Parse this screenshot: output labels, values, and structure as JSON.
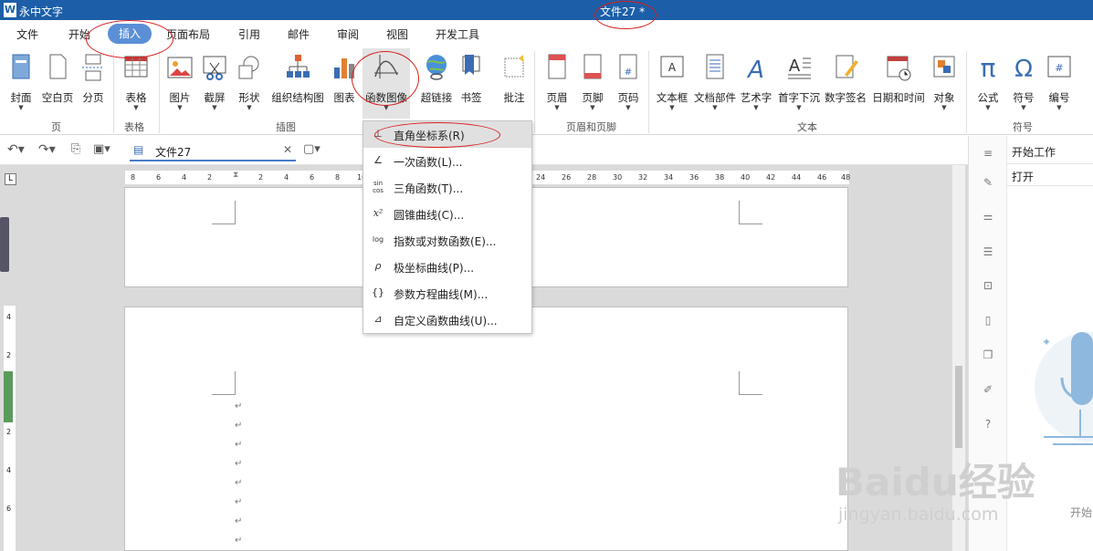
{
  "app": {
    "name": "永中文字",
    "document_title": "文件27 *"
  },
  "menu": [
    "文件",
    "开始",
    "插入",
    "页面布局",
    "引用",
    "邮件",
    "审阅",
    "视图",
    "开发工具"
  ],
  "ribbon": {
    "buttons": [
      "封面",
      "空白页",
      "分页",
      "表格",
      "图片",
      "截屏",
      "形状",
      "组织结构图",
      "图表",
      "函数图像",
      "超链接",
      "书签",
      "批注",
      "页眉",
      "页脚",
      "页码",
      "文本框",
      "文档部件",
      "艺术字",
      "首字下沉",
      "数字签名",
      "日期和时间",
      "对象",
      "公式",
      "符号",
      "编号"
    ],
    "groups": [
      "页",
      "表格",
      "插图",
      "页眉和页脚",
      "文本",
      "符号"
    ]
  },
  "quickbar": {
    "doc_tab": "文件27"
  },
  "dropdown": [
    {
      "label": "直角坐标系(R)",
      "icon": "⊥"
    },
    {
      "label": "一次函数(L)...",
      "icon": "∠"
    },
    {
      "label": "三角函数(T)...",
      "icon": "sin cos"
    },
    {
      "label": "圆锥曲线(C)...",
      "icon": "x²"
    },
    {
      "label": "指数或对数函数(E)...",
      "icon": "log"
    },
    {
      "label": "极坐标曲线(P)...",
      "icon": "ρ"
    },
    {
      "label": "参数方程曲线(M)...",
      "icon": "{}"
    },
    {
      "label": "自定义函数曲线(U)...",
      "icon": "⊿"
    }
  ],
  "ruler": {
    "left_ticks": [
      "8",
      "6",
      "4",
      "2",
      "2",
      "4",
      "6",
      "8",
      "10"
    ],
    "right_ticks": [
      "24",
      "26",
      "28",
      "30",
      "32",
      "34",
      "36",
      "38",
      "40",
      "42",
      "44",
      "46",
      "48"
    ]
  },
  "vruler": [
    "4",
    "2",
    "2",
    "4",
    "6"
  ],
  "sidepanel": {
    "start_work": "开始工作",
    "open": "打开",
    "bottom_text": "开始"
  },
  "watermark": {
    "main": "Baidu经验",
    "url": "jingyan.baidu.com"
  },
  "colors": {
    "titlebar": "#1c5fa8",
    "accent": "#5b8fd6",
    "annotation": "#d81e1e"
  }
}
